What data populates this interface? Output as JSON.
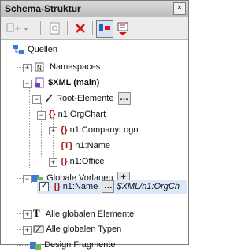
{
  "window": {
    "title": "Schema-Struktur",
    "close": "×"
  },
  "tree": {
    "root": "Quellen",
    "namespaces": "Namespaces",
    "xml_main": "$XML (main)",
    "root_elements": "Root-Elemente",
    "orgchart": "n1:OrgChart",
    "companylogo": "n1:CompanyLogo",
    "name": "n1:Name",
    "office": "n1:Office",
    "global_templates": "Globale Vorlagen",
    "global_template_name": "n1:Name",
    "global_template_path": "$XML/n1:OrgCh",
    "all_global_elements": "Alle globalen Elemente",
    "all_global_types": "Alle globalen Typen",
    "design_fragments": "Design Fragmente"
  }
}
